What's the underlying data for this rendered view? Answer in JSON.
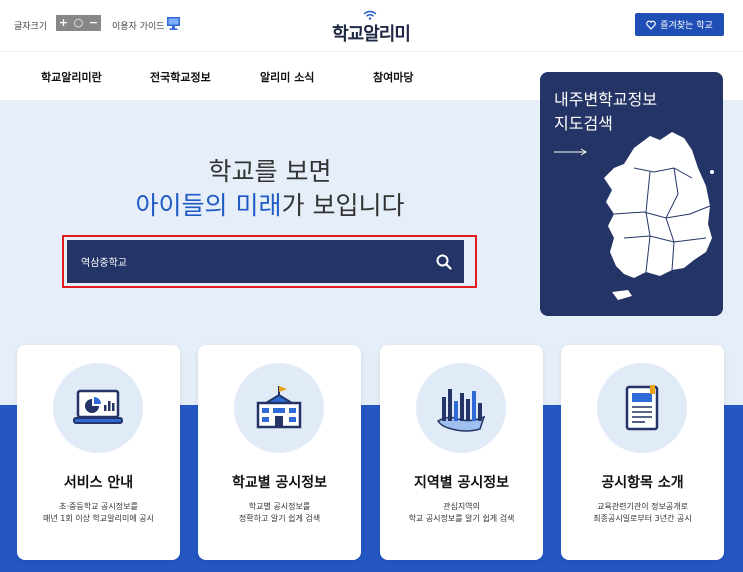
{
  "topbar": {
    "font_size_label": "글자크기",
    "font_size_controls": [
      "+",
      "○",
      "−"
    ],
    "guide_label": "이용자 가이드",
    "logo_text": "학교알리미",
    "favorite_button": "즐겨찾는 학교"
  },
  "nav": {
    "items": [
      "학교알리미란",
      "전국학교정보",
      "알리미 소식",
      "참여마당"
    ]
  },
  "hero": {
    "line1": "학교를 보면",
    "line2_highlight_a": "아이들의",
    "line2_space": " ",
    "line2_highlight_b": "미래",
    "line2_rest": "가 보입니다"
  },
  "search": {
    "value": "역삼중학교"
  },
  "map_card": {
    "title_line1": "내주변학교정보",
    "title_line2": "지도검색"
  },
  "cards": [
    {
      "title": "서비스 안내",
      "desc1": "초·중등학교 공시정보를",
      "desc2": "매년 1회 이상 학교알리미에 공시",
      "icon": "laptop-chart-icon"
    },
    {
      "title": "학교별 공시정보",
      "desc1": "학교별 공시정보를",
      "desc2": "정확하고 알기 쉽게 검색",
      "icon": "school-building-icon"
    },
    {
      "title": "지역별 공시정보",
      "desc1": "관심지역의",
      "desc2": "학교 공시정보를 알기 쉽게 검색",
      "icon": "regional-bar-chart-icon"
    },
    {
      "title": "공시항목 소개",
      "desc1": "교육관련기관이 정보공개로",
      "desc2": "최종공시일로부터 3년간 공시",
      "icon": "document-icon"
    }
  ],
  "colors": {
    "brand_navy": "#243466",
    "brand_blue": "#1f4fb4",
    "highlight_blue": "#1f5bc4",
    "hero_bg": "#e5eef9",
    "band_blue": "#2557c3",
    "search_outline": "#e01b22"
  }
}
